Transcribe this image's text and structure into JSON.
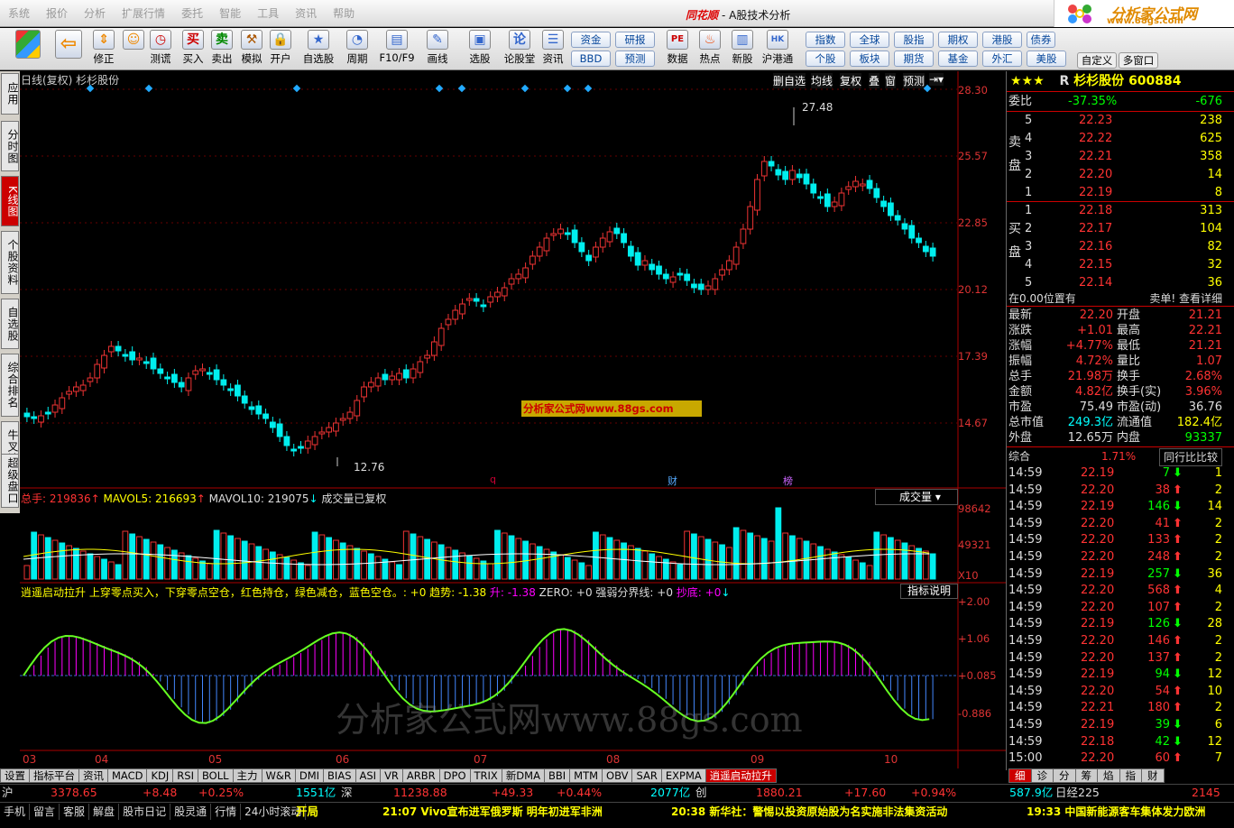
{
  "menu": [
    "系统",
    "报价",
    "分析",
    "扩展行情",
    "委托",
    "智能",
    "工具",
    "资讯",
    "帮助"
  ],
  "app_title": {
    "brand": "同花顺",
    "subtitle": "- A股技术分析"
  },
  "logo": {
    "line1": "分析家公式网",
    "line2": "www.88gs.com"
  },
  "toolbar": {
    "buttons": [
      {
        "label": "",
        "icon": "app-grid-icon"
      },
      {
        "label": "",
        "icon": "back-arrow-icon"
      },
      {
        "label": "修正",
        "icon": "up-down-icon"
      },
      {
        "label": "测谎",
        "icon": "clock-icon"
      },
      {
        "label": "买入",
        "icon": "buy-icon"
      },
      {
        "label": "卖出",
        "icon": "sell-icon"
      },
      {
        "label": "模拟",
        "icon": "hammer-icon"
      },
      {
        "label": "开户",
        "icon": "lock-icon"
      },
      {
        "label": "自选股",
        "icon": "star-icon"
      },
      {
        "label": "周期",
        "icon": "cycle-icon"
      },
      {
        "label": "F10/F9",
        "icon": "f10-icon"
      },
      {
        "label": "画线",
        "icon": "pen-icon"
      },
      {
        "label": "选股",
        "icon": "monitor-icon"
      },
      {
        "label": "论股堂",
        "icon": "forum-icon"
      },
      {
        "label": "资讯",
        "icon": "news-icon"
      },
      {
        "label": "数据",
        "icon": "pe-icon"
      },
      {
        "label": "热点",
        "icon": "fire-icon"
      },
      {
        "label": "新股",
        "icon": "newstock-icon"
      },
      {
        "label": "沪港通",
        "icon": "hk-icon"
      }
    ],
    "quick_left": [
      "资金",
      "研报",
      "BBD",
      "预测"
    ],
    "quick_right": [
      [
        "指数",
        "全球",
        "股指",
        "期权",
        "港股",
        "债券"
      ],
      [
        "个股",
        "板块",
        "期货",
        "基金",
        "外汇",
        "美股"
      ]
    ],
    "extra": [
      "自定义",
      "多窗口"
    ]
  },
  "left_tabs": [
    "应用",
    "分时图",
    "K线图",
    "个股资料",
    "自选股",
    "综合排名",
    "牛叉诊股",
    "超级盘口"
  ],
  "chart": {
    "title": "日线(复权) 杉杉股份",
    "header_buttons": [
      "删自选",
      "均线",
      "复权",
      "叠",
      "窗",
      "预测"
    ],
    "price_axis": [
      "28.30",
      "25.57",
      "22.85",
      "20.12",
      "17.39",
      "14.67"
    ],
    "high_label": "27.48",
    "low_label": "12.76",
    "watermark_box": "分析家公式网www.88gs.com",
    "watermark_big": "分析家公式网www.88gs.com",
    "markers": [
      "q",
      "财",
      "榜"
    ],
    "vol_header": {
      "a": "总手: 219836",
      "b": "MAVOL5: 216693",
      "c": "MAVOL10: 219075",
      "d": "成交量已复权",
      "e": "成交量"
    },
    "vol_axis": [
      "98642",
      "49321",
      "X10"
    ],
    "ind_header": "逍遥启动拉升  上穿零点买入，下穿零点空仓，红色持仓，绿色减仓，蓝色空仓。: +0 趋势: -1.38",
    "ind_header2": "升: -1.38",
    "ind_header3": "ZERO: +0 强弱分界线: +0",
    "ind_header4": "抄底: +0",
    "ind_btn": "指标说明",
    "ind_axis": [
      "+2.00",
      "+1.06",
      "+0.085",
      "-0.886"
    ],
    "months": [
      "03",
      "04",
      "05",
      "06",
      "07",
      "08",
      "09",
      "10"
    ]
  },
  "bottom_tabs": [
    "设置",
    "指标平台",
    "资讯",
    "MACD",
    "KDJ",
    "RSI",
    "BOLL",
    "主力",
    "W&R",
    "DMI",
    "BIAS",
    "ASI",
    "VR",
    "ARBR",
    "DPO",
    "TRIX",
    "新DMA",
    "BBI",
    "MTM",
    "OBV",
    "SAR",
    "EXPMA",
    "逍遥启动拉升"
  ],
  "stock": {
    "stars": "★★★",
    "prefix": "R",
    "name": "杉杉股份",
    "code": "600884",
    "weibi_label": "委比",
    "weibi": "-37.35%",
    "weicha": "-676",
    "sell_label": [
      "卖",
      "盘"
    ],
    "buy_label": [
      "买",
      "盘"
    ],
    "asks": [
      [
        "5",
        "22.23",
        "238"
      ],
      [
        "4",
        "22.22",
        "625"
      ],
      [
        "3",
        "22.21",
        "358"
      ],
      [
        "2",
        "22.20",
        "14"
      ],
      [
        "1",
        "22.19",
        "8"
      ]
    ],
    "bids": [
      [
        "1",
        "22.18",
        "313"
      ],
      [
        "2",
        "22.17",
        "104"
      ],
      [
        "3",
        "22.16",
        "82"
      ],
      [
        "4",
        "22.15",
        "32"
      ],
      [
        "5",
        "22.14",
        "36"
      ]
    ],
    "pos_text": "在0.00位置有",
    "pos_btn": "卖单! 查看详细",
    "quote": [
      [
        "最新",
        "22.20",
        "开盘",
        "21.21"
      ],
      [
        "涨跌",
        "+1.01",
        "最高",
        "22.21"
      ],
      [
        "涨幅",
        "+4.77%",
        "最低",
        "21.21"
      ],
      [
        "振幅",
        "4.72%",
        "量比",
        "1.07"
      ],
      [
        "总手",
        "21.98万",
        "换手",
        "2.68%"
      ],
      [
        "金额",
        "4.82亿",
        "换手(实)",
        "3.96%"
      ],
      [
        "市盈",
        "75.49",
        "市盈(动)",
        "36.76"
      ],
      [
        "总市值",
        "249.3亿",
        "流通值",
        "182.4亿"
      ],
      [
        "外盘",
        "12.65万",
        "内盘",
        "93337"
      ]
    ],
    "summary": {
      "label": "综合",
      "pct": "1.71%",
      "btn": "同行比比较"
    },
    "ticks": [
      [
        "14:59",
        "22.19",
        "7",
        "down",
        "1"
      ],
      [
        "14:59",
        "22.20",
        "38",
        "up",
        "2"
      ],
      [
        "14:59",
        "22.19",
        "146",
        "down",
        "14"
      ],
      [
        "14:59",
        "22.20",
        "41",
        "up",
        "2"
      ],
      [
        "14:59",
        "22.20",
        "133",
        "up",
        "2"
      ],
      [
        "14:59",
        "22.20",
        "248",
        "up",
        "2"
      ],
      [
        "14:59",
        "22.19",
        "257",
        "down",
        "36"
      ],
      [
        "14:59",
        "22.20",
        "568",
        "up",
        "4"
      ],
      [
        "14:59",
        "22.20",
        "107",
        "up",
        "2"
      ],
      [
        "14:59",
        "22.19",
        "126",
        "down",
        "28"
      ],
      [
        "14:59",
        "22.20",
        "146",
        "up",
        "2"
      ],
      [
        "14:59",
        "22.20",
        "137",
        "up",
        "2"
      ],
      [
        "14:59",
        "22.19",
        "94",
        "down",
        "12"
      ],
      [
        "14:59",
        "22.20",
        "54",
        "up",
        "10"
      ],
      [
        "14:59",
        "22.21",
        "180",
        "up",
        "2"
      ],
      [
        "14:59",
        "22.19",
        "39",
        "down",
        "6"
      ],
      [
        "14:59",
        "22.18",
        "42",
        "down",
        "12"
      ],
      [
        "15:00",
        "22.20",
        "60",
        "up",
        "7"
      ]
    ],
    "rp_tabs": [
      "细",
      "诊",
      "分",
      "筹",
      "焰",
      "指",
      "财"
    ]
  },
  "status1": {
    "sh": "沪",
    "sh_val": "3378.65",
    "sh_chg": "+8.48",
    "sh_pct": "+0.25%",
    "sh_amt": "1551亿",
    "sz": "深",
    "sz_val": "11238.88",
    "sz_chg": "+49.33",
    "sz_pct": "+0.44%",
    "sz_amt": "2077亿",
    "cy": "创",
    "cy_val": "1880.21",
    "cy_chg": "+17.60",
    "cy_pct": "+0.94%",
    "cy_amt": "587.9亿",
    "rj": "日经225",
    "rj_val": "2145"
  },
  "status2": {
    "items": [
      "手机",
      "留言",
      "客服",
      "解盘",
      "股市日记",
      "股灵通",
      "行情",
      "24小时滚动"
    ],
    "kai": "开局",
    "n1": "21:07 Vivo宣布进军俄罗斯 明年初进军非洲",
    "n2": "20:38 新华社：警惕以投资原始股为名实施非法集资活动",
    "n3": "19:33 中国新能源客车集体发力欧洲"
  }
}
